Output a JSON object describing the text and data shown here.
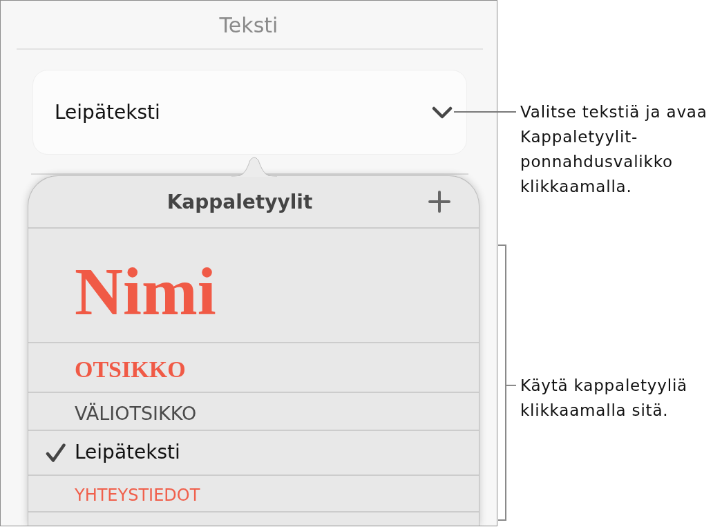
{
  "sidebar": {
    "title": "Teksti",
    "style_dropdown": {
      "value": "Leipäteksti"
    }
  },
  "popover": {
    "title": "Kappaletyylit",
    "styles": [
      {
        "kind": "title",
        "label": "Nimi",
        "selected": false
      },
      {
        "kind": "heading",
        "label": "OTSIKKO",
        "selected": false
      },
      {
        "kind": "subheading",
        "label": "VÄLIOTSIKKO",
        "selected": false
      },
      {
        "kind": "body",
        "label": "Leipäteksti",
        "selected": true
      },
      {
        "kind": "contact",
        "label": "YHTEYSTIEDOT",
        "selected": false
      }
    ]
  },
  "callouts": [
    {
      "kind": "leader",
      "text": "Valitse tekstiä ja avaa Kappaletyylit-ponnahdusvalikko klikkaamalla."
    },
    {
      "kind": "bracket",
      "text": "Käytä kappaletyyliä klikkaamalla sitä."
    }
  ]
}
